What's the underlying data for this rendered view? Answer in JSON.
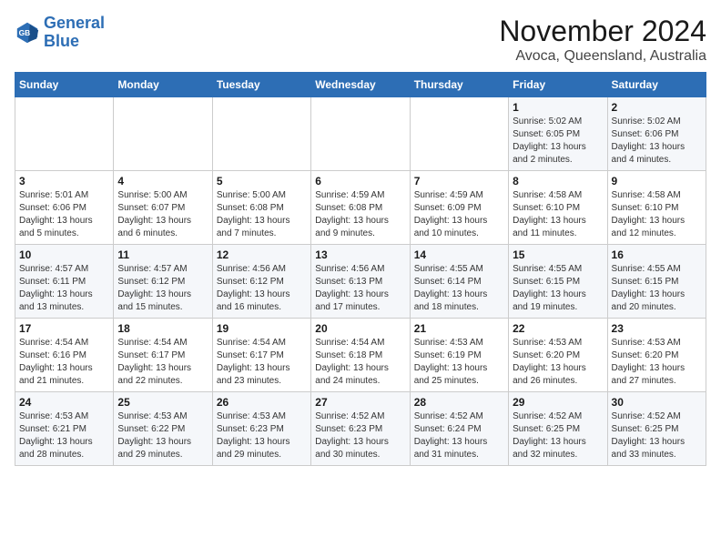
{
  "logo": {
    "line1": "General",
    "line2": "Blue"
  },
  "title": "November 2024",
  "location": "Avoca, Queensland, Australia",
  "weekdays": [
    "Sunday",
    "Monday",
    "Tuesday",
    "Wednesday",
    "Thursday",
    "Friday",
    "Saturday"
  ],
  "weeks": [
    [
      {
        "day": "",
        "sunrise": "",
        "sunset": "",
        "daylight": ""
      },
      {
        "day": "",
        "sunrise": "",
        "sunset": "",
        "daylight": ""
      },
      {
        "day": "",
        "sunrise": "",
        "sunset": "",
        "daylight": ""
      },
      {
        "day": "",
        "sunrise": "",
        "sunset": "",
        "daylight": ""
      },
      {
        "day": "",
        "sunrise": "",
        "sunset": "",
        "daylight": ""
      },
      {
        "day": "1",
        "sunrise": "Sunrise: 5:02 AM",
        "sunset": "Sunset: 6:05 PM",
        "daylight": "Daylight: 13 hours and 2 minutes."
      },
      {
        "day": "2",
        "sunrise": "Sunrise: 5:02 AM",
        "sunset": "Sunset: 6:06 PM",
        "daylight": "Daylight: 13 hours and 4 minutes."
      }
    ],
    [
      {
        "day": "3",
        "sunrise": "Sunrise: 5:01 AM",
        "sunset": "Sunset: 6:06 PM",
        "daylight": "Daylight: 13 hours and 5 minutes."
      },
      {
        "day": "4",
        "sunrise": "Sunrise: 5:00 AM",
        "sunset": "Sunset: 6:07 PM",
        "daylight": "Daylight: 13 hours and 6 minutes."
      },
      {
        "day": "5",
        "sunrise": "Sunrise: 5:00 AM",
        "sunset": "Sunset: 6:08 PM",
        "daylight": "Daylight: 13 hours and 7 minutes."
      },
      {
        "day": "6",
        "sunrise": "Sunrise: 4:59 AM",
        "sunset": "Sunset: 6:08 PM",
        "daylight": "Daylight: 13 hours and 9 minutes."
      },
      {
        "day": "7",
        "sunrise": "Sunrise: 4:59 AM",
        "sunset": "Sunset: 6:09 PM",
        "daylight": "Daylight: 13 hours and 10 minutes."
      },
      {
        "day": "8",
        "sunrise": "Sunrise: 4:58 AM",
        "sunset": "Sunset: 6:10 PM",
        "daylight": "Daylight: 13 hours and 11 minutes."
      },
      {
        "day": "9",
        "sunrise": "Sunrise: 4:58 AM",
        "sunset": "Sunset: 6:10 PM",
        "daylight": "Daylight: 13 hours and 12 minutes."
      }
    ],
    [
      {
        "day": "10",
        "sunrise": "Sunrise: 4:57 AM",
        "sunset": "Sunset: 6:11 PM",
        "daylight": "Daylight: 13 hours and 13 minutes."
      },
      {
        "day": "11",
        "sunrise": "Sunrise: 4:57 AM",
        "sunset": "Sunset: 6:12 PM",
        "daylight": "Daylight: 13 hours and 15 minutes."
      },
      {
        "day": "12",
        "sunrise": "Sunrise: 4:56 AM",
        "sunset": "Sunset: 6:12 PM",
        "daylight": "Daylight: 13 hours and 16 minutes."
      },
      {
        "day": "13",
        "sunrise": "Sunrise: 4:56 AM",
        "sunset": "Sunset: 6:13 PM",
        "daylight": "Daylight: 13 hours and 17 minutes."
      },
      {
        "day": "14",
        "sunrise": "Sunrise: 4:55 AM",
        "sunset": "Sunset: 6:14 PM",
        "daylight": "Daylight: 13 hours and 18 minutes."
      },
      {
        "day": "15",
        "sunrise": "Sunrise: 4:55 AM",
        "sunset": "Sunset: 6:15 PM",
        "daylight": "Daylight: 13 hours and 19 minutes."
      },
      {
        "day": "16",
        "sunrise": "Sunrise: 4:55 AM",
        "sunset": "Sunset: 6:15 PM",
        "daylight": "Daylight: 13 hours and 20 minutes."
      }
    ],
    [
      {
        "day": "17",
        "sunrise": "Sunrise: 4:54 AM",
        "sunset": "Sunset: 6:16 PM",
        "daylight": "Daylight: 13 hours and 21 minutes."
      },
      {
        "day": "18",
        "sunrise": "Sunrise: 4:54 AM",
        "sunset": "Sunset: 6:17 PM",
        "daylight": "Daylight: 13 hours and 22 minutes."
      },
      {
        "day": "19",
        "sunrise": "Sunrise: 4:54 AM",
        "sunset": "Sunset: 6:17 PM",
        "daylight": "Daylight: 13 hours and 23 minutes."
      },
      {
        "day": "20",
        "sunrise": "Sunrise: 4:54 AM",
        "sunset": "Sunset: 6:18 PM",
        "daylight": "Daylight: 13 hours and 24 minutes."
      },
      {
        "day": "21",
        "sunrise": "Sunrise: 4:53 AM",
        "sunset": "Sunset: 6:19 PM",
        "daylight": "Daylight: 13 hours and 25 minutes."
      },
      {
        "day": "22",
        "sunrise": "Sunrise: 4:53 AM",
        "sunset": "Sunset: 6:20 PM",
        "daylight": "Daylight: 13 hours and 26 minutes."
      },
      {
        "day": "23",
        "sunrise": "Sunrise: 4:53 AM",
        "sunset": "Sunset: 6:20 PM",
        "daylight": "Daylight: 13 hours and 27 minutes."
      }
    ],
    [
      {
        "day": "24",
        "sunrise": "Sunrise: 4:53 AM",
        "sunset": "Sunset: 6:21 PM",
        "daylight": "Daylight: 13 hours and 28 minutes."
      },
      {
        "day": "25",
        "sunrise": "Sunrise: 4:53 AM",
        "sunset": "Sunset: 6:22 PM",
        "daylight": "Daylight: 13 hours and 29 minutes."
      },
      {
        "day": "26",
        "sunrise": "Sunrise: 4:53 AM",
        "sunset": "Sunset: 6:23 PM",
        "daylight": "Daylight: 13 hours and 29 minutes."
      },
      {
        "day": "27",
        "sunrise": "Sunrise: 4:52 AM",
        "sunset": "Sunset: 6:23 PM",
        "daylight": "Daylight: 13 hours and 30 minutes."
      },
      {
        "day": "28",
        "sunrise": "Sunrise: 4:52 AM",
        "sunset": "Sunset: 6:24 PM",
        "daylight": "Daylight: 13 hours and 31 minutes."
      },
      {
        "day": "29",
        "sunrise": "Sunrise: 4:52 AM",
        "sunset": "Sunset: 6:25 PM",
        "daylight": "Daylight: 13 hours and 32 minutes."
      },
      {
        "day": "30",
        "sunrise": "Sunrise: 4:52 AM",
        "sunset": "Sunset: 6:25 PM",
        "daylight": "Daylight: 13 hours and 33 minutes."
      }
    ]
  ]
}
